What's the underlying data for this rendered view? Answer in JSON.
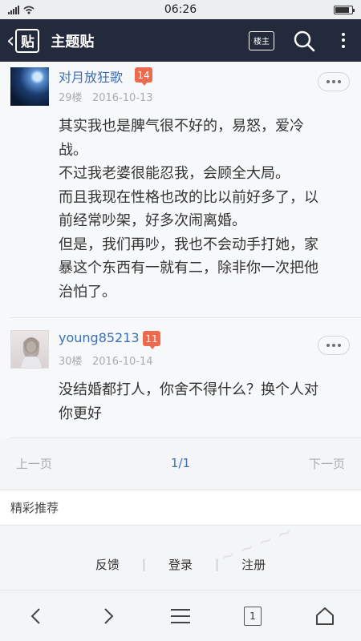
{
  "status_bar": {
    "time": "06:26",
    "signal_icon": "signal-icon",
    "wifi_icon": "wifi-icon",
    "battery_icon": "battery-icon"
  },
  "header": {
    "title": "主题贴",
    "logo_text": "贴",
    "op_only_label": "楼主",
    "bg_color": "#232a3b"
  },
  "posts": [
    {
      "username": "对月放狂歌",
      "level": "14",
      "floor": "29楼",
      "date": "2016-10-13",
      "content": "其实我也是脾气很不好的，易怒，爱冷\n战。\n不过我老婆很能忍我，会顾全大局。\n而且我现在性格也改的比以前好多了，以\n前经常吵架，好多次闹离婚。\n但是，我们再吵，我也不会动手打她，家\n暴这个东西有一就有二，除非你一次把他\n治怕了。"
    },
    {
      "username": "young85213",
      "level": "11",
      "floor": "30楼",
      "date": "2016-10-14",
      "content": "没结婚都打人，你舍不得什么？换个人对\n你更好"
    }
  ],
  "pager": {
    "prev": "上一页",
    "current": "1/1",
    "next": "下一页"
  },
  "recommend": {
    "label": "精彩推荐"
  },
  "footer_links": {
    "feedback": "反馈",
    "login": "登录",
    "register": "注册",
    "sep": "|"
  },
  "bottom_nav": {
    "tab_count": "1"
  },
  "colors": {
    "accent": "#3a6fb7",
    "level_badge": "#ee6a4f"
  }
}
